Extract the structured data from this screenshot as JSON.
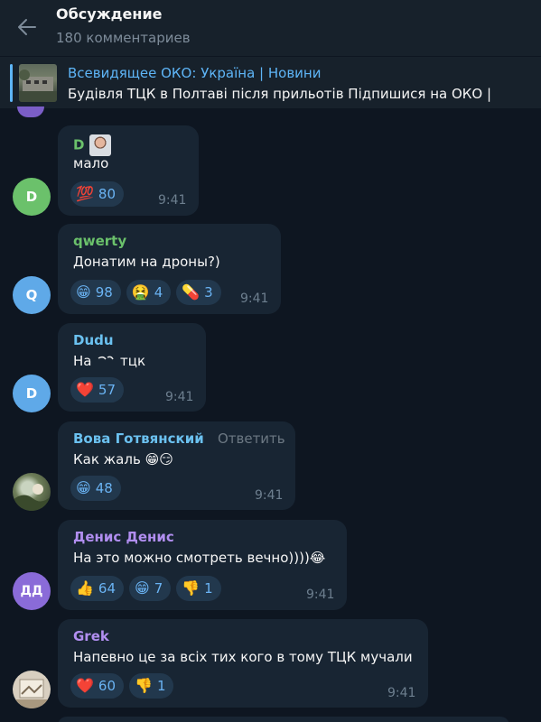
{
  "header": {
    "title": "Обсуждение",
    "subtitle": "180 комментариев"
  },
  "pinned": {
    "title": "Всевидящее ОКО: Україна | Новини",
    "text": "Будівля ТЦК в Полтаві після прильотів  Підпишися на ОКО |"
  },
  "messages": [
    {
      "avatar_letter": "D",
      "avatar_color": "#6bc16b",
      "sender": "D",
      "text": "мало",
      "reactions": [
        {
          "emoji": "💯",
          "count": "80"
        }
      ],
      "time": "9:41"
    },
    {
      "avatar_letter": "Q",
      "avatar_color": "#5fa9e8",
      "sender": "qwerty",
      "sender_color": "#6bc16b",
      "text": "Донатим на дроны?)",
      "reactions": [
        {
          "emoji": "😁",
          "count": "98"
        },
        {
          "emoji": "🤮",
          "count": "4"
        },
        {
          "emoji": "💊",
          "count": "3"
        }
      ],
      "time": "9:41"
    },
    {
      "avatar_letter": "D",
      "avatar_color": "#5fa9e8",
      "sender": "Dudu",
      "sender_color": "#6bc1f0",
      "text_before": "На",
      "text_after": "тцк",
      "reactions": [
        {
          "emoji": "❤️",
          "count": "57"
        }
      ],
      "time": "9:41"
    },
    {
      "sender": "Вова Готвянский",
      "sender_color": "#6bc1f0",
      "reply_label": "Ответить",
      "text": "Как жаль 😁😏",
      "reactions": [
        {
          "emoji": "😁",
          "count": "48"
        }
      ],
      "time": "9:41"
    },
    {
      "avatar_letter": "ДД",
      "avatar_color": "#8a6bd8",
      "sender": "Денис Денис",
      "sender_color": "#b18ef0",
      "text": "На это можно смотреть вечно))))😂",
      "reactions": [
        {
          "emoji": "👍",
          "count": "64"
        },
        {
          "emoji": "😁",
          "count": "7"
        },
        {
          "emoji": "👎",
          "count": "1"
        }
      ],
      "time": "9:41"
    },
    {
      "sender": "Grek",
      "sender_color": "#b18ef0",
      "text": "Напевно це за всіх тих кого в тому ТЦК мучали",
      "reactions": [
        {
          "emoji": "❤️",
          "count": "60"
        },
        {
          "emoji": "👎",
          "count": "1"
        }
      ],
      "time": "9:41"
    }
  ]
}
